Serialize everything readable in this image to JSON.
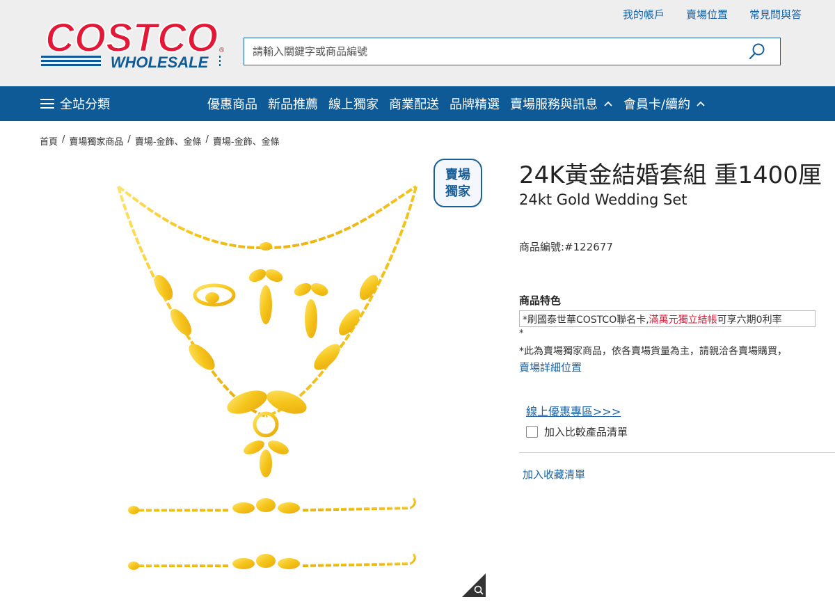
{
  "header": {
    "logo_top": "COSTCO",
    "logo_bottom": "WHOLESALE",
    "links": [
      "我的帳戶",
      "賣場位置",
      "常見問與答"
    ],
    "search_placeholder": "請輸入關鍵字或商品編號"
  },
  "nav": {
    "category_label": "全站分類",
    "items": [
      "優惠商品",
      "新品推薦",
      "線上獨家",
      "商業配送",
      "品牌精選",
      "賣場服務與訊息",
      "會員卡/續約"
    ]
  },
  "breadcrumb": [
    "首頁",
    "賣場獨家商品",
    "賣場-金飾、金條",
    "賣場-金飾、金條"
  ],
  "product": {
    "badge_line1": "賣場",
    "badge_line2": "獨家",
    "title": "24K黃金結婚套組 重1400厘",
    "subtitle": "24kt Gold Wedding Set",
    "code": "商品編號:#122677",
    "features_heading": "商品特色",
    "feature_part1": "*刷國泰世華COSTCO聯名卡,",
    "feature_highlight": "滿萬元獨立結帳",
    "feature_part2": "可享六期0利率",
    "star": "*",
    "note": "*此為賣場獨家商品，依各賣場貨量為主，請親洽各賣場購買，",
    "note_link": "賣場詳細位置",
    "promo_link": "線上優惠專區>>>",
    "compare_label": "加入比較產品清單",
    "wishlist_link": "加入收藏清單"
  },
  "colors": {
    "brand_red": "#e31837",
    "brand_blue": "#0e5a96",
    "link_blue": "#1a62a5",
    "gold": "#f5cc2a"
  }
}
